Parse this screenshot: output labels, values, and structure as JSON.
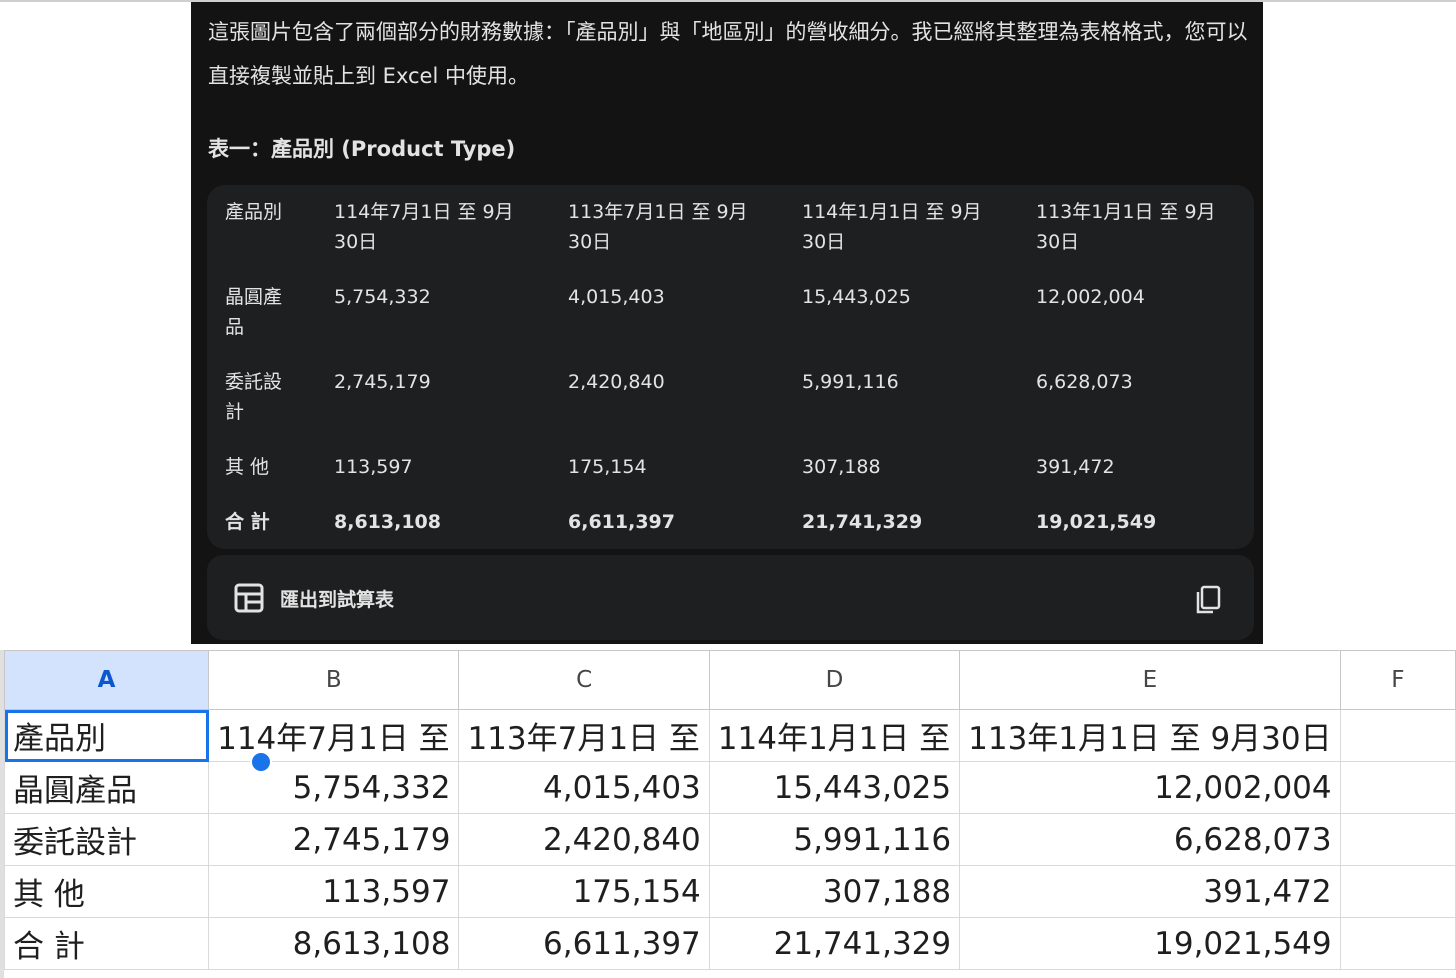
{
  "chat": {
    "intro": "這張圖片包含了兩個部分的財務數據：「產品別」與「地區別」的營收細分。我已經將其整理為表格格式，您可以直接複製並貼上到 Excel 中使用。",
    "section_title": "表一：產品別 (Product Type)",
    "table": {
      "headers": [
        "產品別",
        "114年7月1日 至 9月30日",
        "113年7月1日 至 9月30日",
        "114年1月1日 至 9月30日",
        "113年1月1日 至 9月30日"
      ],
      "rows": [
        [
          "晶圓產品",
          "5,754,332",
          "4,015,403",
          "15,443,025",
          "12,002,004"
        ],
        [
          "委託設計",
          "2,745,179",
          "2,420,840",
          "5,991,116",
          "6,628,073"
        ],
        [
          "其 他",
          "113,597",
          "175,154",
          "307,188",
          "391,472"
        ],
        [
          "合 計",
          "8,613,108",
          "6,611,397",
          "21,741,329",
          "19,021,549"
        ]
      ]
    },
    "export_label": "匯出到試算表",
    "export_icon": "table-icon",
    "copy_icon": "copy-icon"
  },
  "sheet": {
    "columns": [
      "A",
      "B",
      "C",
      "D",
      "E",
      "F"
    ],
    "selected_column": "A",
    "rows": [
      [
        "產品別",
        "114年7月1日 至",
        "113年7月1日 至",
        "114年1月1日 至",
        "113年1月1日 至 9月30日",
        ""
      ],
      [
        "晶圓產品",
        "5,754,332",
        "4,015,403",
        "15,443,025",
        "12,002,004",
        ""
      ],
      [
        "委託設計",
        "2,745,179",
        "2,420,840",
        "5,991,116",
        "6,628,073",
        ""
      ],
      [
        "其 他",
        "113,597",
        "175,154",
        "307,188",
        "391,472",
        ""
      ],
      [
        "合 計",
        "8,613,108",
        "6,611,397",
        "21,741,329",
        "19,021,549",
        ""
      ]
    ],
    "accent_color": "#1a73e8",
    "header_selected_bg": "#d3e3fd"
  }
}
